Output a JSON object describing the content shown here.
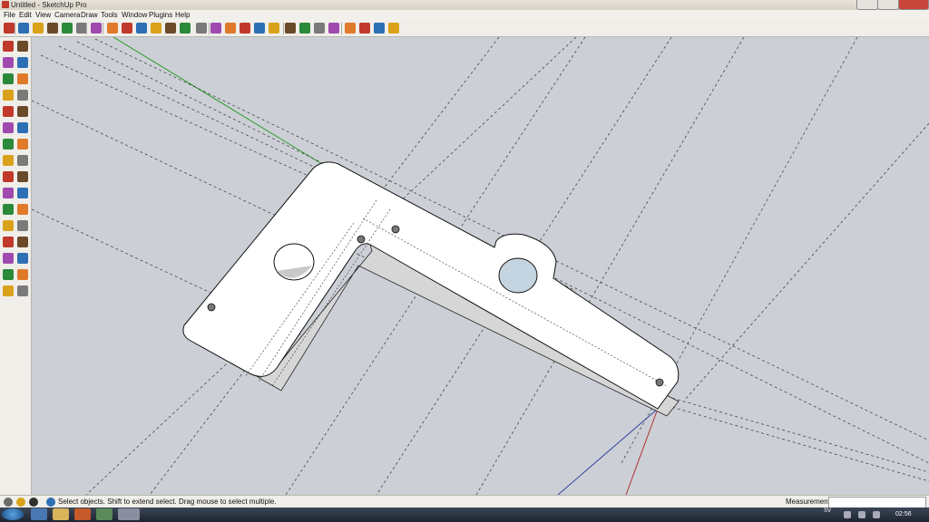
{
  "window": {
    "title": "Untitled - SketchUp Pro"
  },
  "menu": [
    "File",
    "Edit",
    "View",
    "Camera",
    "Draw",
    "Tools",
    "Window",
    "Plugins",
    "Help"
  ],
  "toolbar_icons": [
    "select-icon",
    "eraser-icon",
    "pencil-icon",
    "rectangle-icon",
    "circle-icon",
    "arc-icon",
    "make-component-icon",
    "paint-bucket-icon",
    "eraser-icon",
    "push-pull-icon",
    "move-icon",
    "rotate-icon",
    "follow-me-icon",
    "orbit-icon",
    "pan-icon",
    "zoom-icon",
    "zoom-extents-icon",
    "previous-view-icon",
    "next-view-icon",
    "camera-position-icon",
    "look-around-icon",
    "walk-icon",
    "section-plane-icon",
    "components-icon",
    "warehouse-icon",
    "extension-icon",
    "share-model-icon"
  ],
  "left_tool_icons": [
    "select-icon",
    "eraser-icon",
    "paint-bucket-icon",
    "pencil-icon",
    "rectangle-icon",
    "line-icon",
    "circle-icon",
    "arc-icon",
    "polygon-icon",
    "freehand-icon",
    "move-icon",
    "push-pull-icon",
    "rotate-icon",
    "follow-me-icon",
    "scale-icon",
    "offset-icon",
    "tape-measure-icon",
    "dimension-icon",
    "protractor-icon",
    "text-icon",
    "axes-icon",
    "3d-text-icon",
    "orbit-icon",
    "pan-icon",
    "zoom-icon",
    "zoom-window-icon",
    "zoom-extents-icon",
    "previous-view-icon",
    "position-camera-icon",
    "look-around-icon",
    "walk-icon",
    "section-plane-icon"
  ],
  "status": {
    "text": "Select objects. Shift to extend select. Drag mouse to select multiple.",
    "measurements_label": "Measurements",
    "measurements_value": ""
  },
  "taskbar": {
    "lang": "SV",
    "clock": "02:56"
  },
  "colors": {
    "viewport_bg": "#ccd0d6",
    "model_face": "#ffffff",
    "model_side": "#d5d5d5",
    "red_axis": "#b03030",
    "green_axis": "#2a9a2a",
    "blue_axis": "#3040a0"
  }
}
